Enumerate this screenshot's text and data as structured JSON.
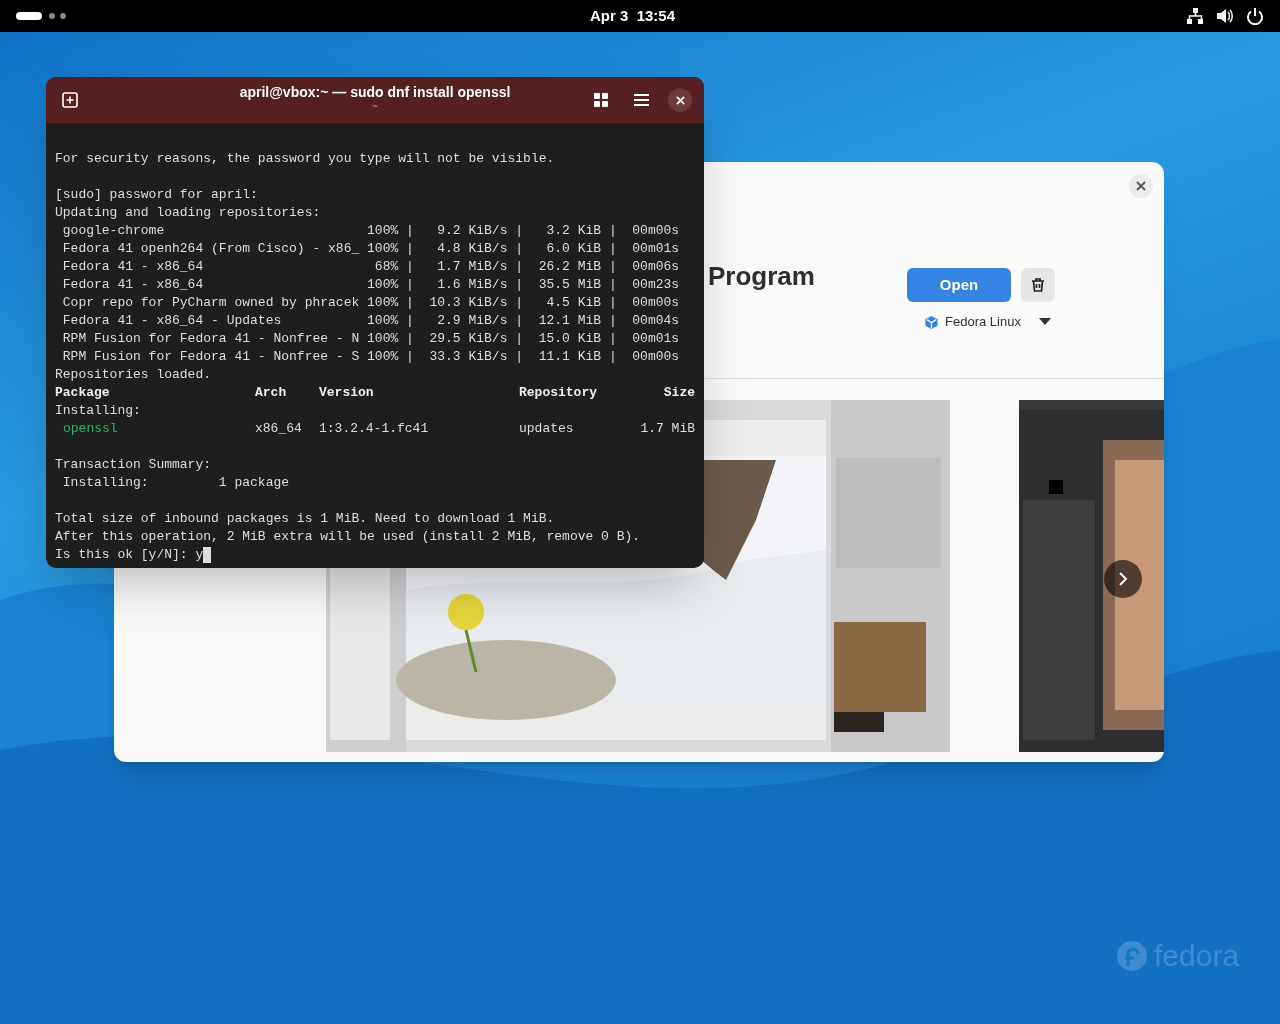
{
  "top_bar": {
    "clock": "Apr 3  13:54"
  },
  "terminal": {
    "title": "april@vbox:~ — sudo dnf install openssl",
    "subtitle": "~",
    "lines": [
      {
        "kind": "blank"
      },
      {
        "kind": "text",
        "text": "For security reasons, the password you type will not be visible."
      },
      {
        "kind": "blank"
      },
      {
        "kind": "text",
        "text": "[sudo] password for april:"
      },
      {
        "kind": "text",
        "text": "Updating and loading repositories:"
      },
      {
        "kind": "text",
        "text": " google-chrome                          100% |   9.2 KiB/s |   3.2 KiB |  00m00s"
      },
      {
        "kind": "text",
        "text": " Fedora 41 openh264 (From Cisco) - x86_ 100% |   4.8 KiB/s |   6.0 KiB |  00m01s"
      },
      {
        "kind": "text",
        "text": " Fedora 41 - x86_64                      68% |   1.7 MiB/s |  26.2 MiB |  00m06s"
      },
      {
        "kind": "text",
        "text": " Fedora 41 - x86_64                     100% |   1.6 MiB/s |  35.5 MiB |  00m23s"
      },
      {
        "kind": "text",
        "text": " Copr repo for PyCharm owned by phracek 100% |  10.3 KiB/s |   4.5 KiB |  00m00s"
      },
      {
        "kind": "text",
        "text": " Fedora 41 - x86_64 - Updates           100% |   2.9 MiB/s |  12.1 MiB |  00m04s"
      },
      {
        "kind": "text",
        "text": " RPM Fusion for Fedora 41 - Nonfree - N 100% |  29.5 KiB/s |  15.0 KiB |  00m01s"
      },
      {
        "kind": "text",
        "text": " RPM Fusion for Fedora 41 - Nonfree - S 100% |  33.3 KiB/s |  11.1 KiB |  00m00s"
      },
      {
        "kind": "text",
        "text": "Repositories loaded."
      },
      {
        "kind": "header",
        "columns": [
          "Package",
          "Arch",
          "Version",
          "Repository",
          "Size"
        ]
      },
      {
        "kind": "text",
        "text": "Installing:"
      },
      {
        "kind": "package",
        "columns": [
          "openssl",
          "x86_64",
          "1:3.2.4-1.fc41",
          "updates",
          "1.7 MiB"
        ]
      },
      {
        "kind": "blank"
      },
      {
        "kind": "text",
        "text": "Transaction Summary:"
      },
      {
        "kind": "text",
        "text": " Installing:         1 package"
      },
      {
        "kind": "blank"
      },
      {
        "kind": "text",
        "text": "Total size of inbound packages is 1 MiB. Need to download 1 MiB."
      },
      {
        "kind": "text",
        "text": "After this operation, 2 MiB extra will be used (install 2 MiB, remove 0 B)."
      },
      {
        "kind": "prompt",
        "text": "Is this ok [y/N]: y"
      }
    ]
  },
  "software": {
    "title": "Program",
    "open_button": "Open",
    "source": "Fedora Linux"
  },
  "wallpaper": {
    "logo": "fedora"
  }
}
